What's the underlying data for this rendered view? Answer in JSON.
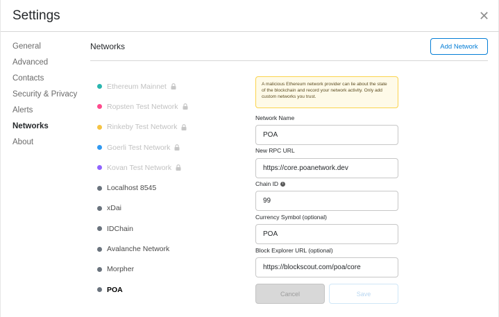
{
  "header": {
    "title": "Settings",
    "close_glyph": "✕"
  },
  "sidebar": {
    "items": [
      {
        "label": "General",
        "active": false
      },
      {
        "label": "Advanced",
        "active": false
      },
      {
        "label": "Contacts",
        "active": false
      },
      {
        "label": "Security & Privacy",
        "active": false
      },
      {
        "label": "Alerts",
        "active": false
      },
      {
        "label": "Networks",
        "active": true
      },
      {
        "label": "About",
        "active": false
      }
    ]
  },
  "main": {
    "title": "Networks",
    "add_network_label": "Add Network",
    "networks": [
      {
        "label": "Ethereum Mainnet",
        "color": "#29b6af",
        "locked": true
      },
      {
        "label": "Ropsten Test Network",
        "color": "#ff4a8d",
        "locked": true
      },
      {
        "label": "Rinkeby Test Network",
        "color": "#f6c343",
        "locked": true
      },
      {
        "label": "Goerli Test Network",
        "color": "#3099f2",
        "locked": true
      },
      {
        "label": "Kovan Test Network",
        "color": "#9064ff",
        "locked": true
      },
      {
        "label": "Localhost 8545",
        "color": "#6a737d",
        "locked": false
      },
      {
        "label": "xDai",
        "color": "#6a737d",
        "locked": false
      },
      {
        "label": "IDChain",
        "color": "#6a737d",
        "locked": false
      },
      {
        "label": "Avalanche Network",
        "color": "#6a737d",
        "locked": false
      },
      {
        "label": "Morpher",
        "color": "#6a737d",
        "locked": false
      },
      {
        "label": "POA",
        "color": "#6a737d",
        "locked": false,
        "selected": true
      }
    ]
  },
  "form": {
    "warning": "A malicious Ethereum network provider can lie about the state of the blockchain and record your network activity. Only add custom networks you trust.",
    "network_name_label": "Network Name",
    "network_name_value": "POA",
    "rpc_url_label": "New RPC URL",
    "rpc_url_value": "https://core.poanetwork.dev",
    "chain_id_label": "Chain ID",
    "chain_id_value": "99",
    "currency_symbol_label": "Currency Symbol (optional)",
    "currency_symbol_value": "POA",
    "explorer_url_label": "Block Explorer URL (optional)",
    "explorer_url_value": "https://blockscout.com/poa/core",
    "cancel_label": "Cancel",
    "save_label": "Save"
  },
  "colors": {
    "accent": "#037dd6",
    "warning_bg": "#fefae8",
    "warning_border": "#fbd34b"
  }
}
